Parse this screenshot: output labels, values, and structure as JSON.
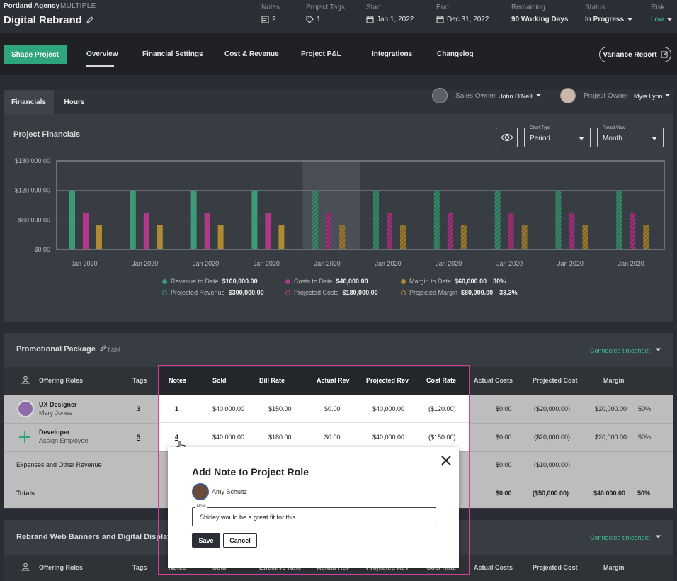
{
  "header": {
    "agency": "Portland Agency",
    "agency_tag": "MULTIPLE",
    "project_title": "Digital Rebrand",
    "notes_label": "Notes",
    "notes_val": "2",
    "tags_label": "Project Tags",
    "tags_val": "1",
    "start_label": "Start",
    "start_val": "Jan 1, 2022",
    "end_label": "End",
    "end_val": "Dec 31, 2022",
    "remaining_label": "Remaining",
    "remaining_val": "90 Working Days",
    "status_label": "Status",
    "status_val": "In Progress",
    "risk_label": "Risk",
    "risk_val": "Low"
  },
  "nav": {
    "shape_btn": "Shape Project",
    "tabs": [
      "Overview",
      "Financial Settings",
      "Cost & Revenue",
      "Project P&L",
      "Integrations",
      "Changelog"
    ],
    "variance_btn": "Variance Report"
  },
  "subtabs": [
    "Financials",
    "Hours"
  ],
  "owners": {
    "sales_label": "Sales Owner",
    "sales_val": "John O'Neill",
    "project_label": "Project Owner",
    "project_val": "Myia Lynn"
  },
  "financials": {
    "title": "Project Financials",
    "chart_type_label": "Chart Type",
    "chart_type_val": "Period",
    "period_view_label": "Period View",
    "period_view_val": "Month"
  },
  "chart_data": {
    "type": "bar",
    "categories": [
      "Jan 2020",
      "Jan 2020",
      "Jan 2020",
      "Jan 2020",
      "Jan 2020",
      "Jan 2020",
      "Jan 2020",
      "Jan 2020",
      "Jan 2020",
      "Jan 2020"
    ],
    "yticks": [
      "$180,000.00",
      "$120,000.00",
      "$60,000.00",
      "$0.00"
    ],
    "ylim": [
      0,
      180000
    ],
    "highlighted_index": 4,
    "projected_from_index": 4,
    "series": [
      {
        "name": "Revenue",
        "color": "#3d9a76",
        "values": [
          120000,
          120000,
          120000,
          120000,
          120000,
          120000,
          120000,
          120000,
          120000,
          120000
        ]
      },
      {
        "name": "Costs",
        "color": "#b1398a",
        "values": [
          75000,
          75000,
          75000,
          75000,
          75000,
          75000,
          75000,
          75000,
          75000,
          75000
        ]
      },
      {
        "name": "Margin",
        "color": "#b08a33",
        "values": [
          50000,
          50000,
          50000,
          50000,
          50000,
          50000,
          50000,
          50000,
          50000,
          50000
        ]
      }
    ],
    "legend": [
      {
        "label": "Revenue to Date",
        "value": "$100,000.00",
        "pct": "",
        "color": "#3d9a76",
        "hollow": false
      },
      {
        "label": "Costs to Date",
        "value": "$40,000.00",
        "pct": "",
        "color": "#b1398a",
        "hollow": false
      },
      {
        "label": "Margin to Date",
        "value": "$60,000.00",
        "pct": "30%",
        "color": "#b08a33",
        "hollow": false
      },
      {
        "label": "Projected Revenue",
        "value": "$300,000.00",
        "pct": "",
        "color": "#3d9a76",
        "hollow": true
      },
      {
        "label": "Projected Costs",
        "value": "$180,000.00",
        "pct": "",
        "color": "#b1398a",
        "hollow": true
      },
      {
        "label": "Projected Margin",
        "value": "$80,000.00",
        "pct": "33.3%",
        "color": "#b08a33",
        "hollow": true
      }
    ]
  },
  "promo": {
    "title": "Promotional Package",
    "type": "T&M",
    "connected": "Connected timesheet",
    "headers": [
      "Offering Roles",
      "Tags",
      "Notes",
      "Sold",
      "Bill Rate",
      "Actual Rev",
      "Projected Rev",
      "Cost Rate",
      "Actual Costs",
      "Projected Cost",
      "Margin"
    ],
    "rows": [
      {
        "role": "UX Designer",
        "person": "Mary Jones",
        "tags": "3",
        "notes": "1",
        "sold": "$40,000.00",
        "bill_rate": "$150.00",
        "actual_rev": "$0.00",
        "projected_rev": "$40,000.00",
        "cost_rate": "($120.00)",
        "actual_costs": "$0.00",
        "projected_cost": "($20,000.00)",
        "margin": "$20,000.00",
        "margin_pct": "50%"
      },
      {
        "role": "Developer",
        "person": "Assign Employee",
        "tags": "5",
        "notes": "4",
        "sold": "$40,000.00",
        "bill_rate": "$180.00",
        "actual_rev": "$0.00",
        "projected_rev": "$40,000.00",
        "cost_rate": "($150.00)",
        "actual_costs": "$0.00",
        "projected_cost": "($20,000.00)",
        "margin": "$20,000.00",
        "margin_pct": "50%"
      }
    ],
    "expenses": {
      "label": "Expenses and Other Revenue",
      "actual_costs": "$0.00",
      "projected_cost": "($10,000.00)"
    },
    "totals": {
      "label": "Totals",
      "actual_costs": "$0.00",
      "projected_cost": "($50,000.00)",
      "margin": "$40,000.00",
      "margin_pct": "50%"
    }
  },
  "modal": {
    "title": "Add Note to Project Role",
    "user": "Amy Schultz",
    "note_label": "Note",
    "note_val": "Shirley would be a great fit for this.",
    "save": "Save",
    "cancel": "Cancel"
  },
  "rebrand": {
    "title": "Rebrand Web Banners and Digital Displays",
    "connected": "Connected timesheet",
    "headers": [
      "Offering Roles",
      "Tags",
      "Notes",
      "Sold",
      "Effective Rate",
      "Actual Rev",
      "Projected Rev",
      "Cost Rate",
      "Actual Costs",
      "Projected Cost",
      "Margin"
    ]
  }
}
